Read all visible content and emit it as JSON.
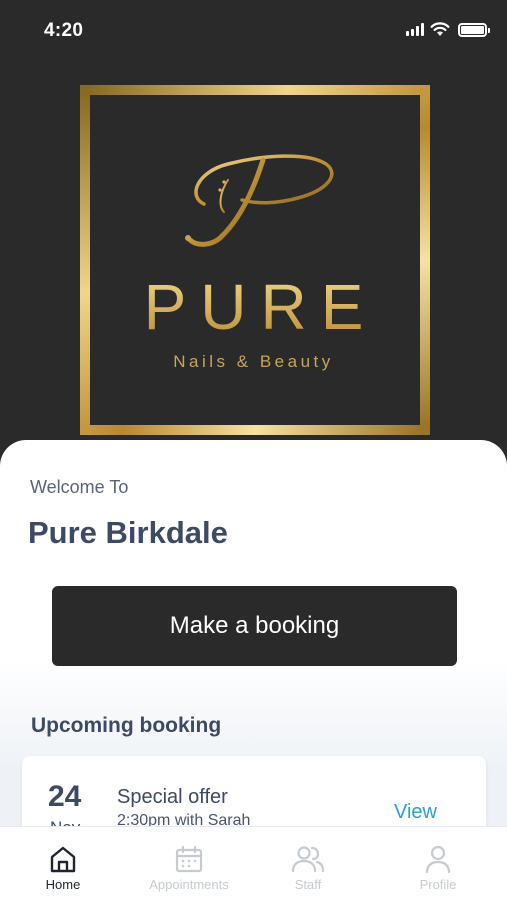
{
  "status_bar": {
    "time": "4:20"
  },
  "logo": {
    "monogram": "P",
    "wordmark": "PURE",
    "tagline": "Nails & Beauty"
  },
  "welcome": {
    "label": "Welcome To",
    "venue": "Pure Birkdale"
  },
  "actions": {
    "booking_button": "Make a booking"
  },
  "upcoming": {
    "title": "Upcoming booking",
    "card": {
      "day": "24",
      "month": "Nov",
      "title": "Special offer",
      "detail": "2:30pm with Sarah",
      "link": "View"
    }
  },
  "tabs": [
    {
      "label": "Home",
      "icon": "home-icon",
      "active": true
    },
    {
      "label": "Appointments",
      "icon": "calendar-icon",
      "active": false
    },
    {
      "label": "Staff",
      "icon": "people-icon",
      "active": false
    },
    {
      "label": "Profile",
      "icon": "person-icon",
      "active": false
    }
  ],
  "colors": {
    "background_dark": "#2a2a2a",
    "gold": "#c9a24a",
    "heading": "#3d4a63",
    "link": "#2a9fd0"
  }
}
